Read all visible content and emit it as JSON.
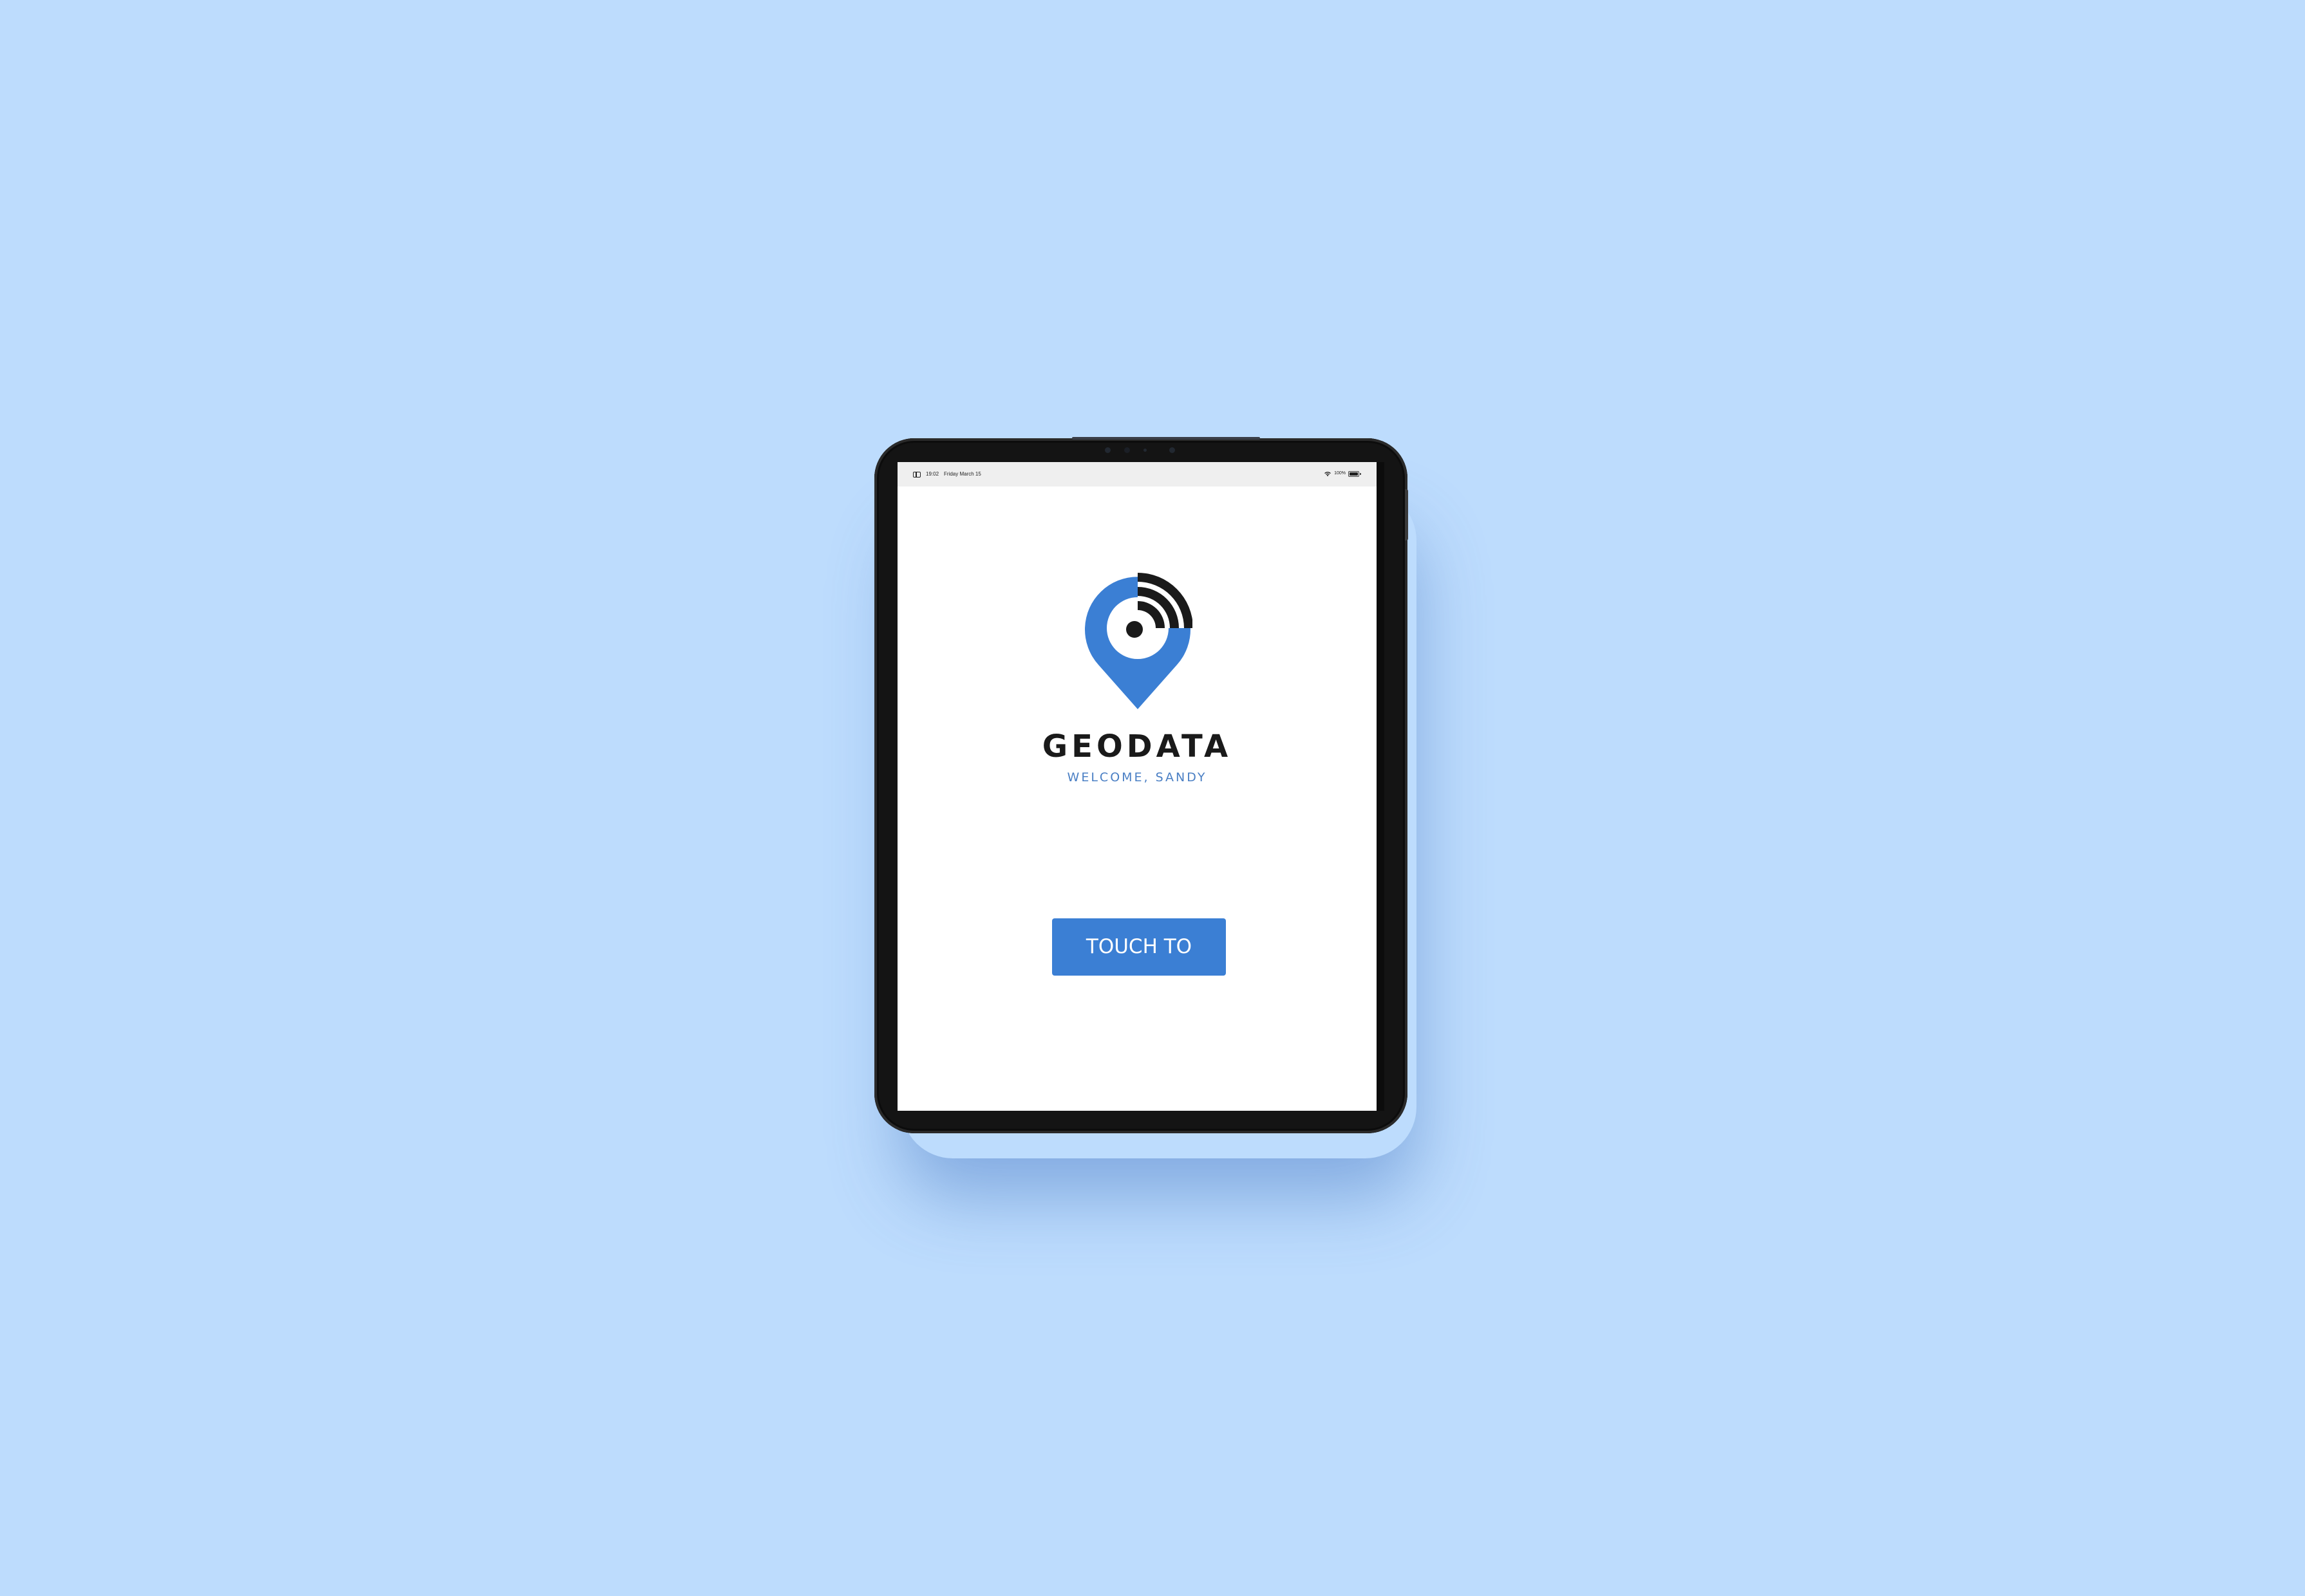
{
  "status_bar": {
    "time": "19:02",
    "date": "Friday March 15",
    "battery_percent": "100%",
    "battery_level": 1.0,
    "icons": {
      "sidebar": "sidebar-icon",
      "wifi": "wifi-icon",
      "battery": "battery-icon"
    }
  },
  "app": {
    "logo": "location-pin-signal-logo",
    "brand_name": "GEODATA",
    "welcome": "WELCOME, SANDY",
    "begin_label": "TOUCH TO BEGIN"
  },
  "colors": {
    "background": "#bddcfd",
    "accent": "#3b7fd4",
    "logo_blue": "#3b7fd4",
    "text_dark": "#1a1a1a",
    "welcome_text": "#4a7fc4",
    "device_frame": "#141414"
  }
}
